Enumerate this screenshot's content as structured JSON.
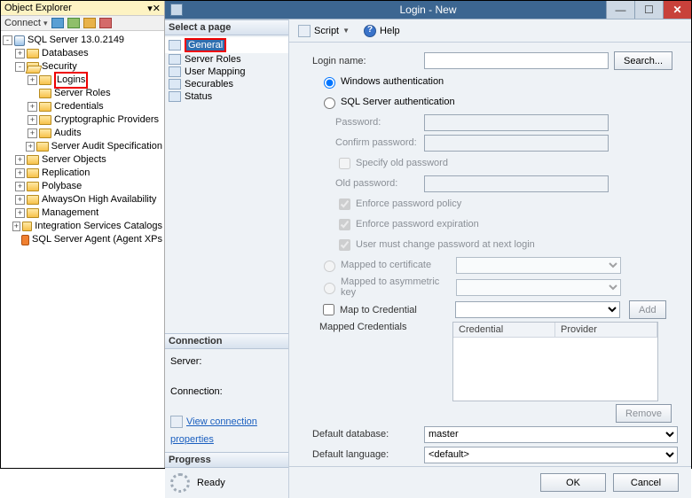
{
  "object_explorer": {
    "title": "Object Explorer",
    "connect_label": "Connect",
    "server_label": "SQL Server 13.0.2149",
    "nodes": {
      "databases": "Databases",
      "security": "Security",
      "logins": "Logins",
      "server_roles": "Server Roles",
      "credentials": "Credentials",
      "crypto": "Cryptographic Providers",
      "audits": "Audits",
      "sas": "Server Audit Specification",
      "server_objects": "Server Objects",
      "replication": "Replication",
      "polybase": "Polybase",
      "alwayson": "AlwaysOn High Availability",
      "management": "Management",
      "isc": "Integration Services Catalogs",
      "agent": "SQL Server Agent (Agent XPs"
    }
  },
  "dialog": {
    "title": "Login - New",
    "select_page": "Select a page",
    "pages": {
      "general": "General",
      "server_roles": "Server Roles",
      "user_mapping": "User Mapping",
      "securables": "Securables",
      "status": "Status"
    },
    "toolbar": {
      "script": "Script",
      "help": "Help"
    },
    "connection_hd": "Connection",
    "server_lbl": "Server:",
    "connection_lbl": "Connection:",
    "view_conn": "View connection properties",
    "progress_hd": "Progress",
    "ready": "Ready",
    "form": {
      "login_name": "Login name:",
      "search": "Search...",
      "win_auth": "Windows authentication",
      "sql_auth": "SQL Server authentication",
      "password": "Password:",
      "confirm": "Confirm password:",
      "specify_old": "Specify old password",
      "old_pw": "Old password:",
      "enforce_policy": "Enforce password policy",
      "enforce_exp": "Enforce password expiration",
      "must_change": "User must change password at next login",
      "mapped_cert": "Mapped to certificate",
      "mapped_asym": "Mapped to asymmetric key",
      "map_cred": "Map to Credential",
      "add": "Add",
      "mapped_creds": "Mapped Credentials",
      "cred_col": "Credential",
      "prov_col": "Provider",
      "remove": "Remove",
      "def_db": "Default database:",
      "def_db_val": "master",
      "def_lang": "Default language:",
      "def_lang_val": "<default>",
      "ok": "OK",
      "cancel": "Cancel"
    }
  }
}
